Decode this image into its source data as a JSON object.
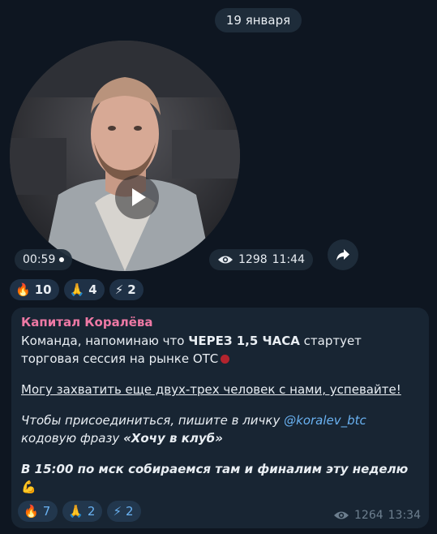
{
  "date_separator": "19 января",
  "video_message": {
    "duration": "00:59",
    "views": "1298",
    "time": "11:44",
    "reactions": [
      {
        "emoji": "🔥",
        "icon": "fire",
        "count": "10"
      },
      {
        "emoji": "🙏",
        "icon": "praying-hands",
        "count": "4"
      },
      {
        "emoji": "⚡",
        "icon": "lightning",
        "count": "2"
      }
    ]
  },
  "text_message": {
    "sender": "Капитал Коралёва",
    "line1_before": "Команда, напоминаю что ",
    "line1_bold": "ЧЕРЕЗ 1,5 ЧАСА",
    "line1_after": " стартует  торговая сессия на рынке ОТС",
    "line2_underline": "Могу захватить еще двух-трех человек с нами, успевайте!",
    "line3_before": "Чтобы присоединиться, пишите в личку ",
    "line3_mention": "@koralev_btc",
    "line3_after": " кодовую фразу ",
    "line3_bold": "«Хочу в клуб»",
    "line4_bold": "В 15:00 по мск собираемся там и финалим эту неделю",
    "line4_emoji": "💪",
    "views": "1264",
    "time": "13:34",
    "reactions": [
      {
        "emoji": "🔥",
        "icon": "fire",
        "count": "7"
      },
      {
        "emoji": "🙏",
        "icon": "praying-hands",
        "count": "2"
      },
      {
        "emoji": "⚡",
        "icon": "lightning",
        "count": "2"
      }
    ]
  },
  "colors": {
    "background": "#0e1621",
    "bubble": "#182533",
    "sender": "#ee79a5",
    "link": "#6ab2f2",
    "meta": "#6d7f8f"
  }
}
